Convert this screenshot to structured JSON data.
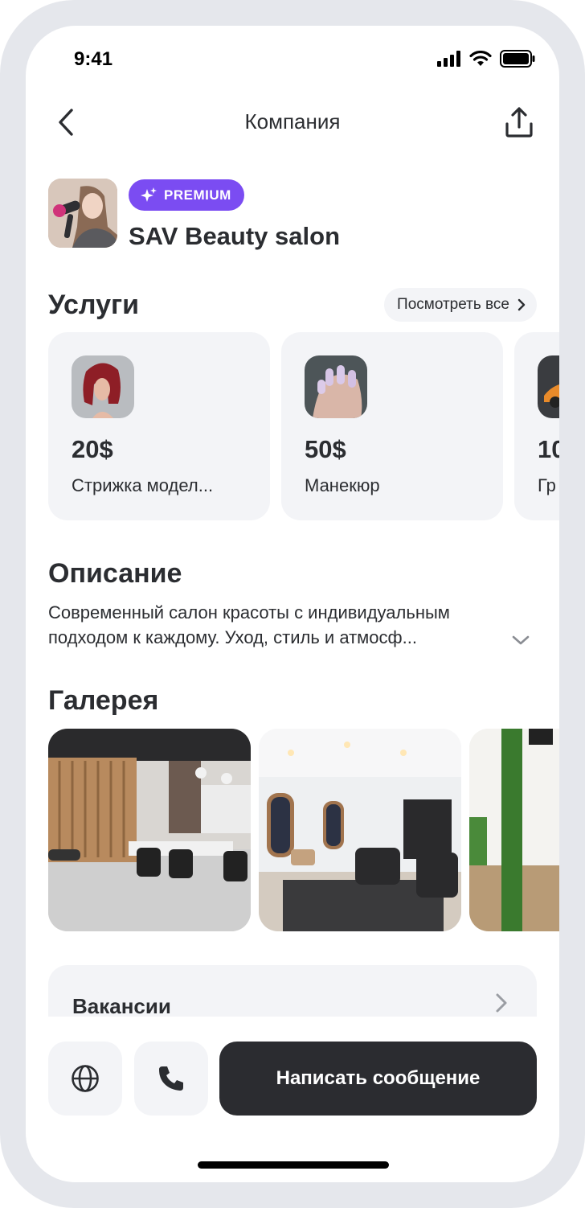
{
  "status_bar": {
    "time": "9:41"
  },
  "nav": {
    "title": "Компания",
    "back_icon": "chevron-left-icon",
    "share_icon": "share-icon"
  },
  "company": {
    "badge": "PREMIUM",
    "name": "SAV Beauty salon"
  },
  "services": {
    "title": "Услуги",
    "see_all": "Посмотреть все",
    "items": [
      {
        "price": "20$",
        "name": "Стрижка модел..."
      },
      {
        "price": "50$",
        "name": "Манекюр"
      },
      {
        "price": "10",
        "name": "Гр"
      }
    ]
  },
  "description": {
    "title": "Описание",
    "line1": "Современный салон красоты с индивидуальным",
    "line2": "подходом к каждому. Уход, стиль и атмосф..."
  },
  "gallery": {
    "title": "Галерея"
  },
  "vacancies": {
    "label": "Вакансии"
  },
  "bottom": {
    "message_button": "Написать сообщение"
  },
  "colors": {
    "accent": "#7b4cf2",
    "card_bg": "#f3f4f7",
    "dark_button": "#2b2c30",
    "text": "#2b2d31"
  }
}
